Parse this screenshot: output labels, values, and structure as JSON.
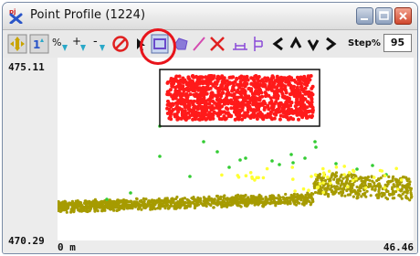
{
  "window": {
    "title": "Point Profile (1224)"
  },
  "toolbar": {
    "icons": [
      "move-icon",
      "line-number-icon",
      "add-points-icon",
      "add-point-icon",
      "remove-point-icon",
      "cancel-icon",
      "arrow-select-icon",
      "rectangle-select-icon",
      "polygon-select-icon",
      "line-select-icon",
      "clear-select-icon",
      "horizontal-profile-icon",
      "vertical-profile-icon",
      "step-left-icon",
      "step-up-icon",
      "step-down-icon",
      "step-right-icon"
    ],
    "step_label": "Step%",
    "step_value": "95"
  },
  "axes": {
    "y_max": "475.11",
    "y_min": "470.29",
    "x_min": "0 m",
    "x_max": "46.46"
  },
  "colors": {
    "selected_points": "#ff1a1a",
    "ground_points": "#a69b00",
    "vegetation_points": "#33cc33",
    "highlight_points": "#ffff33",
    "highlight_circle": "#e8141b"
  }
}
